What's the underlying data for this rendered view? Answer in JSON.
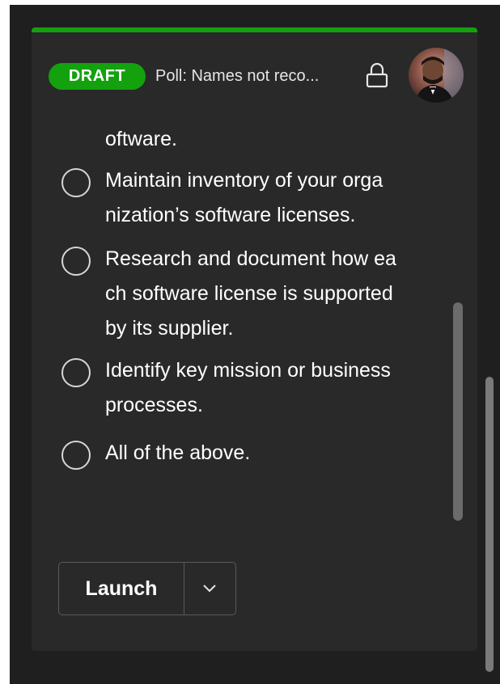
{
  "card": {
    "badge": "DRAFT",
    "title": "Poll: Names not reco...",
    "accent_color": "#13a10e",
    "icons": {
      "lock": "lock-icon",
      "avatar": "user-avatar"
    }
  },
  "poll": {
    "partial_option_text": "oftware.",
    "options": [
      {
        "text": "Maintain inventory of your orga\nnization’s software licenses."
      },
      {
        "text": "Research and document how ea\nch software license is supported\nby its supplier."
      },
      {
        "text": "Identify key mission or business\nprocesses."
      },
      {
        "text": "All of the above."
      }
    ]
  },
  "actions": {
    "launch_label": "Launch",
    "dropdown_icon": "chevron-down-icon"
  }
}
